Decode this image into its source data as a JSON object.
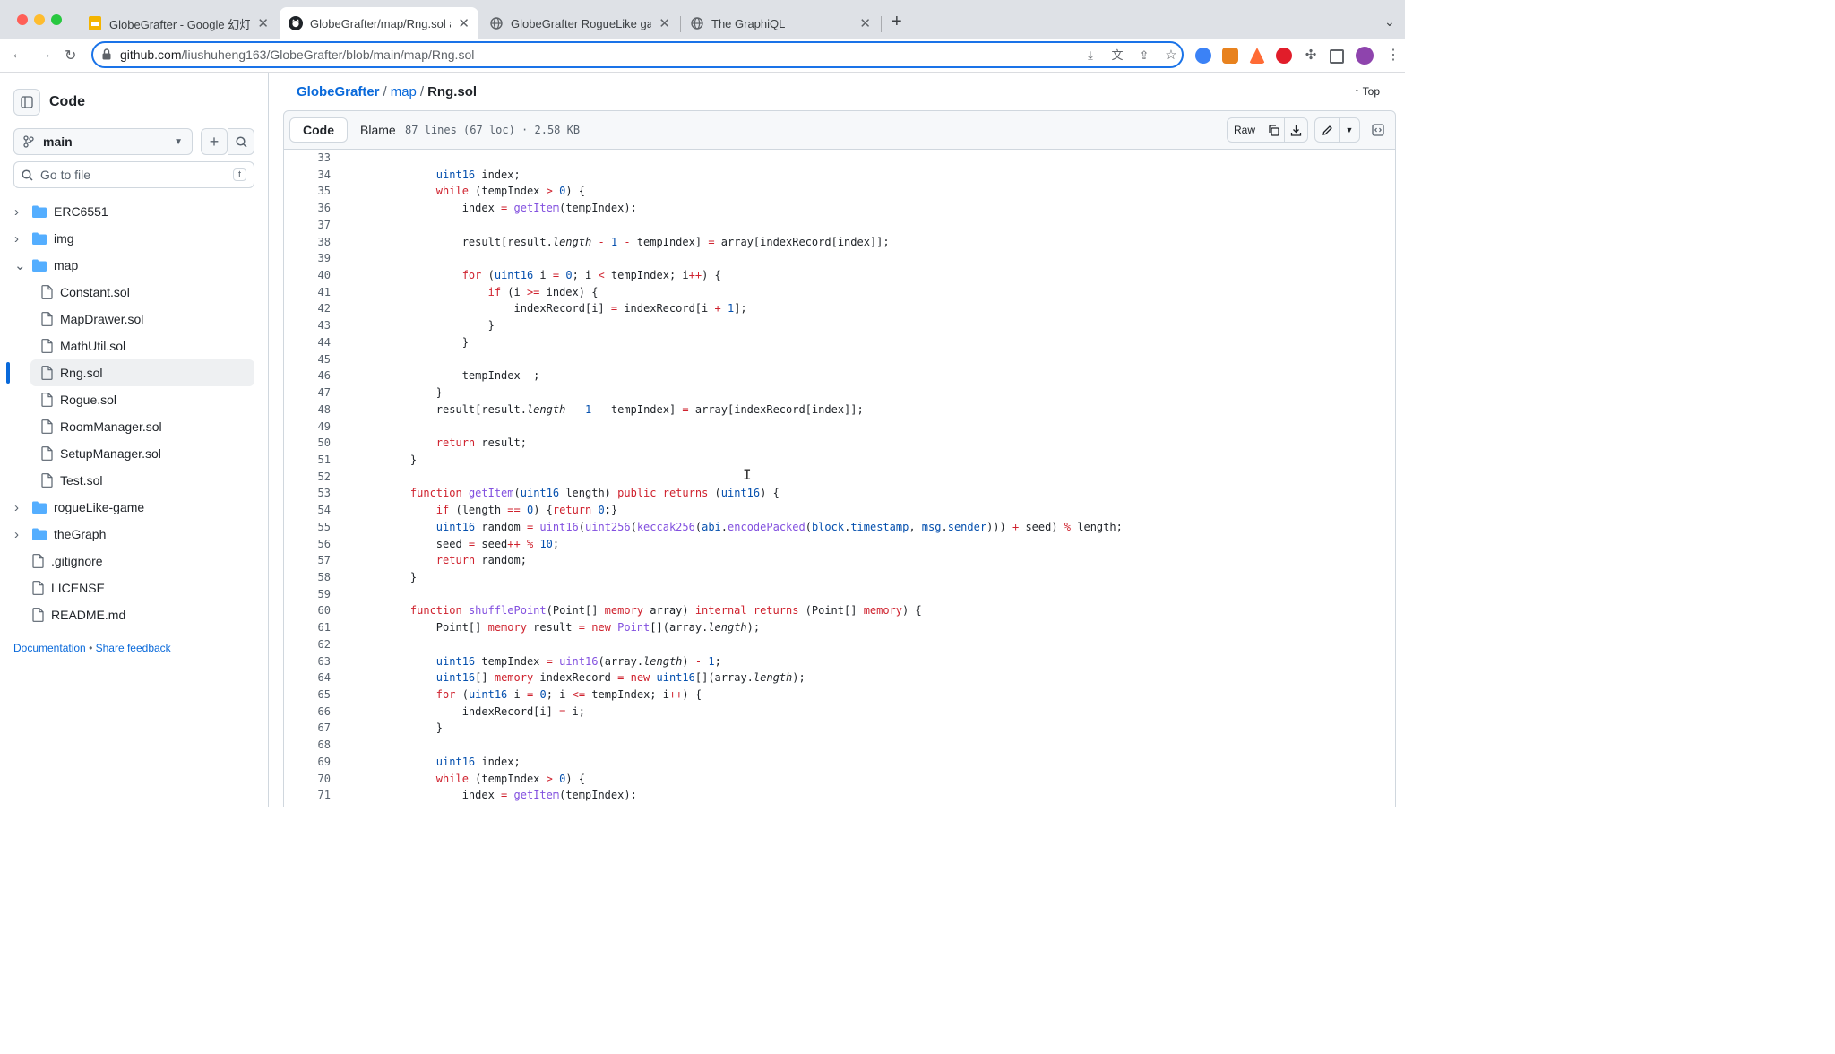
{
  "browser": {
    "tabs": [
      {
        "label": "GlobeGrafter - Google 幻灯片",
        "icon": "google-slides-icon",
        "active": false
      },
      {
        "label": "GlobeGrafter/map/Rng.sol at m",
        "icon": "github-icon",
        "active": true
      },
      {
        "label": "GlobeGrafter RogueLike game",
        "icon": "globe-icon",
        "active": false
      },
      {
        "label": "The GraphiQL",
        "icon": "globe-icon",
        "active": false
      }
    ],
    "url_host": "github.com",
    "url_path": "/liushuheng163/GlobeGrafter/blob/main/map/Rng.sol"
  },
  "sidebar": {
    "title": "Code",
    "branch": "main",
    "search_placeholder": "Go to file",
    "search_shortcut": "t",
    "tree": [
      {
        "label": "ERC6551",
        "type": "folder",
        "expanded": false
      },
      {
        "label": "img",
        "type": "folder",
        "expanded": false
      },
      {
        "label": "map",
        "type": "folder",
        "expanded": true
      },
      {
        "label": "Constant.sol",
        "type": "file",
        "child": true
      },
      {
        "label": "MapDrawer.sol",
        "type": "file",
        "child": true
      },
      {
        "label": "MathUtil.sol",
        "type": "file",
        "child": true
      },
      {
        "label": "Rng.sol",
        "type": "file",
        "child": true,
        "selected": true
      },
      {
        "label": "Rogue.sol",
        "type": "file",
        "child": true
      },
      {
        "label": "RoomManager.sol",
        "type": "file",
        "child": true
      },
      {
        "label": "SetupManager.sol",
        "type": "file",
        "child": true
      },
      {
        "label": "Test.sol",
        "type": "file",
        "child": true
      },
      {
        "label": "rogueLike-game",
        "type": "folder",
        "expanded": false
      },
      {
        "label": "theGraph",
        "type": "folder",
        "expanded": false
      },
      {
        "label": ".gitignore",
        "type": "file"
      },
      {
        "label": "LICENSE",
        "type": "file"
      },
      {
        "label": "README.md",
        "type": "file"
      }
    ],
    "footer_doc": "Documentation",
    "footer_sep": "•",
    "footer_feedback": "Share feedback"
  },
  "file": {
    "breadcrumb_repo": "GlobeGrafter",
    "breadcrumb_dir": "map",
    "breadcrumb_file": "Rng.sol",
    "breadcrumb_sep": "/",
    "top_label": "Top",
    "tab_code": "Code",
    "tab_blame": "Blame",
    "meta": "87 lines (67 loc) · 2.58 KB",
    "raw_label": "Raw"
  },
  "code_lines": [
    {
      "n": 33,
      "html": ""
    },
    {
      "n": 34,
      "html": "        <span class=\"t\">uint16</span> index;"
    },
    {
      "n": 35,
      "html": "        <span class=\"k\">while</span> (tempIndex <span class=\"k\">&gt;</span> <span class=\"t\">0</span>) {"
    },
    {
      "n": 36,
      "html": "            index <span class=\"k\">=</span> <span class=\"f\">getItem</span>(tempIndex);"
    },
    {
      "n": 37,
      "html": ""
    },
    {
      "n": 38,
      "html": "            result[result.<span class=\"i\">length</span> <span class=\"k\">-</span> <span class=\"t\">1</span> <span class=\"k\">-</span> tempIndex] <span class=\"k\">=</span> array[indexRecord[index]];"
    },
    {
      "n": 39,
      "html": ""
    },
    {
      "n": 40,
      "html": "            <span class=\"k\">for</span> (<span class=\"t\">uint16</span> i <span class=\"k\">=</span> <span class=\"t\">0</span>; i <span class=\"k\">&lt;</span> tempIndex; i<span class=\"k\">++</span>) {"
    },
    {
      "n": 41,
      "html": "                <span class=\"k\">if</span> (i <span class=\"k\">&gt;=</span> index) {"
    },
    {
      "n": 42,
      "html": "                    indexRecord[i] <span class=\"k\">=</span> indexRecord[i <span class=\"k\">+</span> <span class=\"t\">1</span>];"
    },
    {
      "n": 43,
      "html": "                }"
    },
    {
      "n": 44,
      "html": "            }"
    },
    {
      "n": 45,
      "html": ""
    },
    {
      "n": 46,
      "html": "            tempIndex<span class=\"k\">--</span>;"
    },
    {
      "n": 47,
      "html": "        }"
    },
    {
      "n": 48,
      "html": "        result[result.<span class=\"i\">length</span> <span class=\"k\">-</span> <span class=\"t\">1</span> <span class=\"k\">-</span> tempIndex] <span class=\"k\">=</span> array[indexRecord[index]];"
    },
    {
      "n": 49,
      "html": ""
    },
    {
      "n": 50,
      "html": "        <span class=\"k\">return</span> result;"
    },
    {
      "n": 51,
      "html": "    }"
    },
    {
      "n": 52,
      "html": ""
    },
    {
      "n": 53,
      "html": "    <span class=\"k\">function</span> <span class=\"f\">getItem</span>(<span class=\"t\">uint16</span> length) <span class=\"k\">public</span> <span class=\"k\">returns</span> (<span class=\"t\">uint16</span>) {"
    },
    {
      "n": 54,
      "html": "        <span class=\"k\">if</span> (length <span class=\"k\">==</span> <span class=\"t\">0</span>) {<span class=\"k\">return</span> <span class=\"t\">0</span>;}"
    },
    {
      "n": 55,
      "html": "        <span class=\"t\">uint16</span> random <span class=\"k\">=</span> <span class=\"f\">uint16</span>(<span class=\"f\">uint256</span>(<span class=\"f\">keccak256</span>(<span class=\"t\">abi</span>.<span class=\"f\">encodePacked</span>(<span class=\"t\">block</span>.<span class=\"t\">timestamp</span>, <span class=\"t\">msg</span>.<span class=\"t\">sender</span>))) <span class=\"k\">+</span> seed) <span class=\"k\">%</span> length;"
    },
    {
      "n": 56,
      "html": "        seed <span class=\"k\">=</span> seed<span class=\"k\">++</span> <span class=\"k\">%</span> <span class=\"t\">10</span>;"
    },
    {
      "n": 57,
      "html": "        <span class=\"k\">return</span> random;"
    },
    {
      "n": 58,
      "html": "    }"
    },
    {
      "n": 59,
      "html": ""
    },
    {
      "n": 60,
      "html": "    <span class=\"k\">function</span> <span class=\"f\">shufflePoint</span>(Point[] <span class=\"k\">memory</span> array) <span class=\"k\">internal</span> <span class=\"k\">returns</span> (Point[] <span class=\"k\">memory</span>) {"
    },
    {
      "n": 61,
      "html": "        Point[] <span class=\"k\">memory</span> result <span class=\"k\">=</span> <span class=\"k\">new</span> <span class=\"f\">Point</span>[](array.<span class=\"i\">length</span>);"
    },
    {
      "n": 62,
      "html": ""
    },
    {
      "n": 63,
      "html": "        <span class=\"t\">uint16</span> tempIndex <span class=\"k\">=</span> <span class=\"f\">uint16</span>(array.<span class=\"i\">length</span>) <span class=\"k\">-</span> <span class=\"t\">1</span>;"
    },
    {
      "n": 64,
      "html": "        <span class=\"t\">uint16</span>[] <span class=\"k\">memory</span> indexRecord <span class=\"k\">=</span> <span class=\"k\">new</span> <span class=\"t\">uint16</span>[](array.<span class=\"i\">length</span>);"
    },
    {
      "n": 65,
      "html": "        <span class=\"k\">for</span> (<span class=\"t\">uint16</span> i <span class=\"k\">=</span> <span class=\"t\">0</span>; i <span class=\"k\">&lt;=</span> tempIndex; i<span class=\"k\">++</span>) {"
    },
    {
      "n": 66,
      "html": "            indexRecord[i] <span class=\"k\">=</span> i;"
    },
    {
      "n": 67,
      "html": "        }"
    },
    {
      "n": 68,
      "html": ""
    },
    {
      "n": 69,
      "html": "        <span class=\"t\">uint16</span> index;"
    },
    {
      "n": 70,
      "html": "        <span class=\"k\">while</span> (tempIndex <span class=\"k\">&gt;</span> <span class=\"t\">0</span>) {"
    },
    {
      "n": 71,
      "html": "            index <span class=\"k\">=</span> <span class=\"f\">getItem</span>(tempIndex);"
    }
  ]
}
